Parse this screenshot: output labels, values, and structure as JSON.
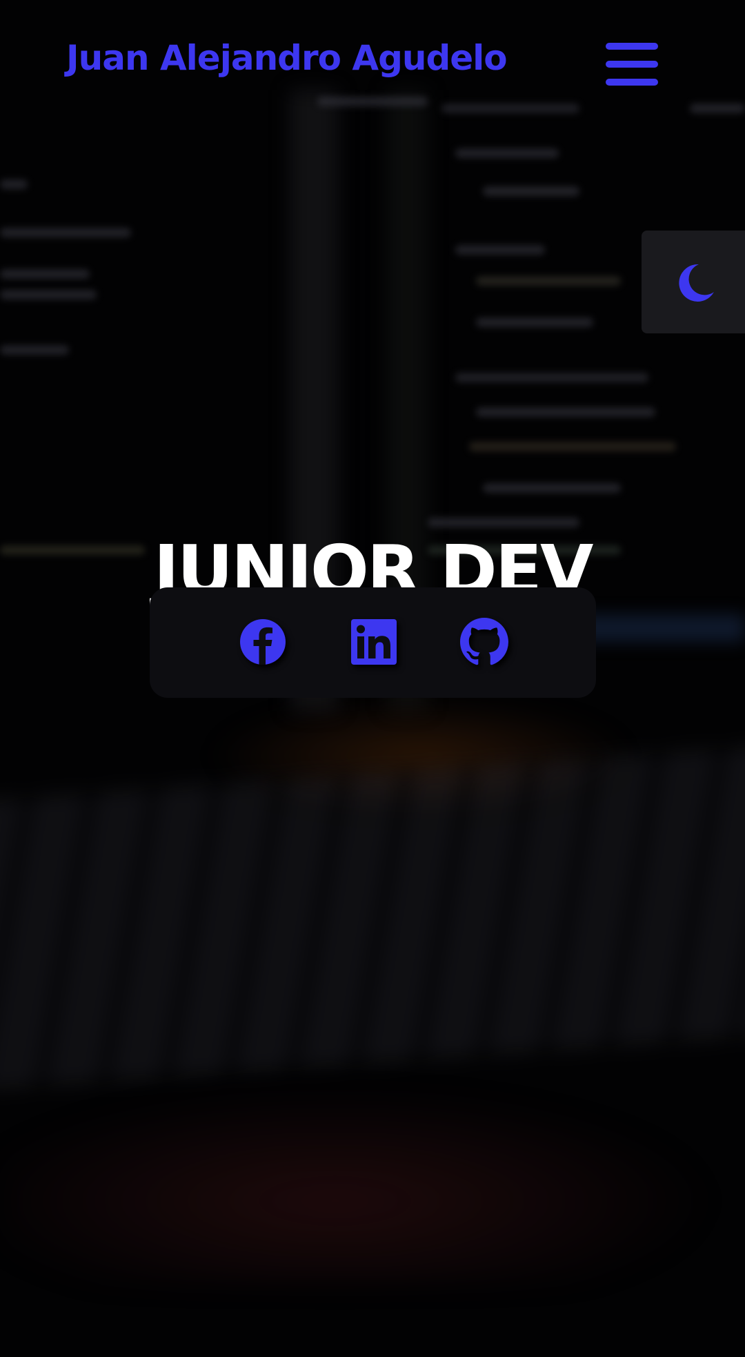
{
  "header": {
    "brand_name": "Juan Alejandro Agudelo",
    "menu_icon": "hamburger-menu-icon"
  },
  "theme_toggle": {
    "icon": "moon-icon"
  },
  "hero": {
    "title": "JUNIOR DEV"
  },
  "social": [
    {
      "icon": "facebook-icon"
    },
    {
      "icon": "linkedin-icon"
    },
    {
      "icon": "github-icon"
    }
  ],
  "colors": {
    "accent": "#3d37f0",
    "background": "#020203",
    "card": "#0d0d11",
    "toggle_bg": "#1a1a1e",
    "title": "#ffffff"
  }
}
